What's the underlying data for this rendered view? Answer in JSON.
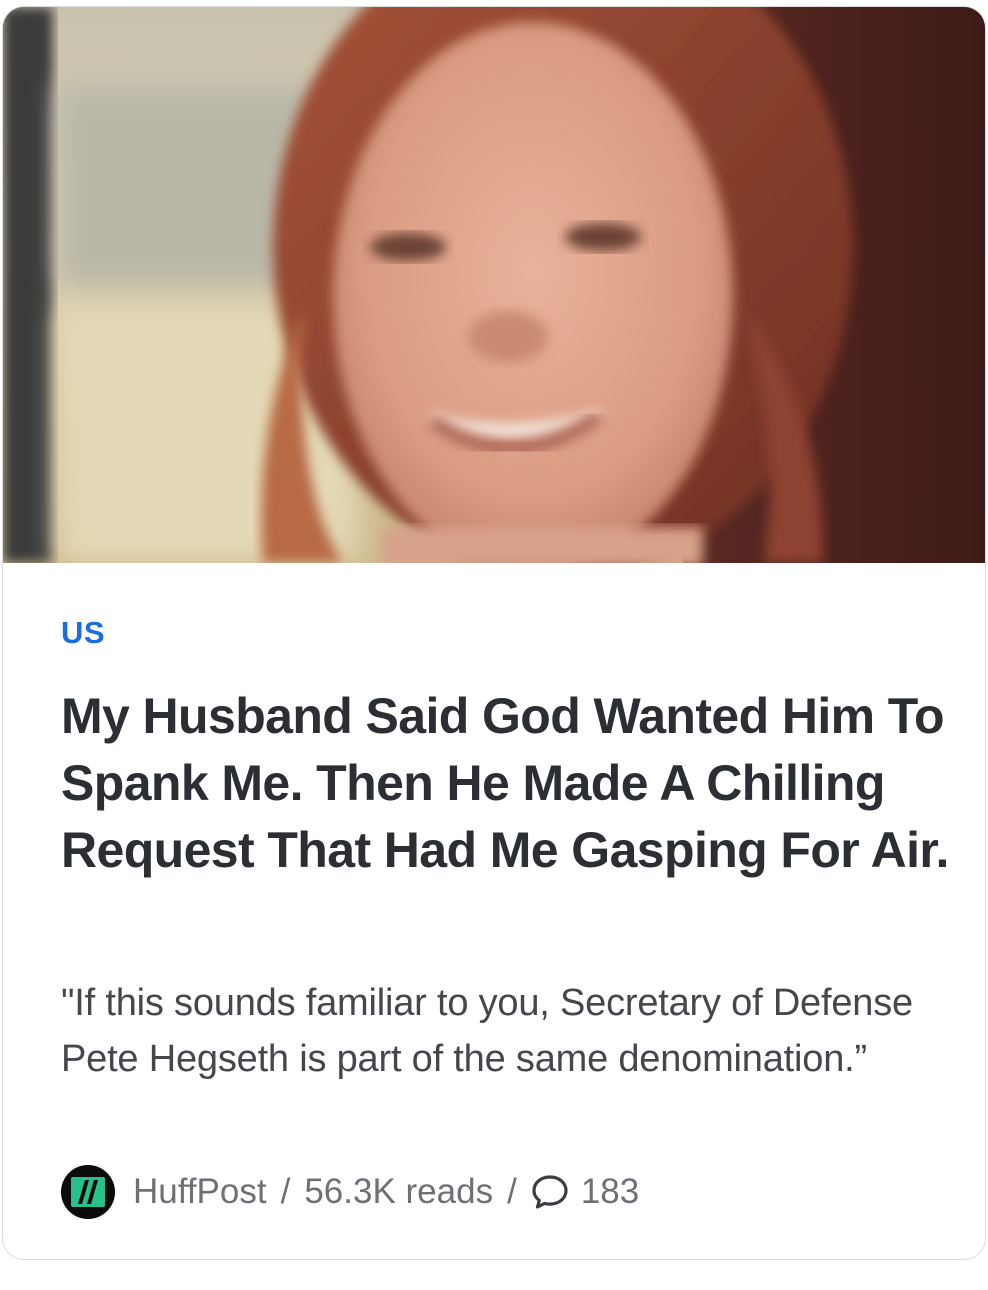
{
  "article": {
    "image_alt": "Smiling woman with red hair",
    "category": "US",
    "headline": "My Husband Said God Wanted Him To Spank Me. Then He Made A Chilling Request That Had Me Gasping For Air.",
    "summary": "\"If this sounds familiar to you, Secretary of Defense Pete Hegseth is part of the same denomination.”",
    "source": "HuffPost",
    "separator": "/",
    "reads": "56.3K reads",
    "comments": "183"
  },
  "icons": {
    "logo": "huffpost-logo-icon",
    "comment": "comment-bubble-icon"
  },
  "colors": {
    "category": "#1a6fdc",
    "headline": "#2b2f33",
    "summary": "#44484d",
    "meta": "#6d7176",
    "logo_green": "#2ac08c"
  }
}
